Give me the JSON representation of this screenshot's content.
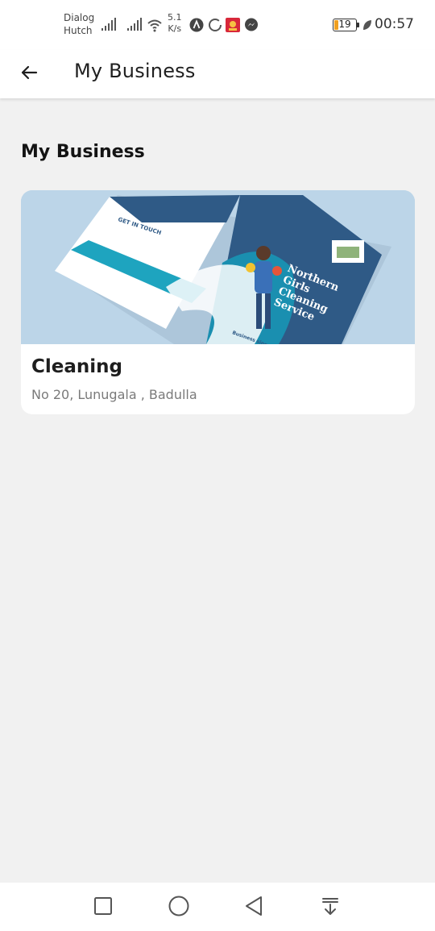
{
  "status_bar": {
    "carrier_line1": "Dialog",
    "carrier_line2": "Hutch",
    "speed_value": "5.1",
    "speed_unit": "K/s",
    "battery_level": "19",
    "battery_fraction": 0.19,
    "time": "00:57",
    "icons": [
      "signal-icon",
      "signal-icon",
      "wifi-icon",
      "app-a-icon",
      "loading-ring-icon",
      "app-red-icon",
      "messenger-icon",
      "battery-icon",
      "leaf-icon"
    ]
  },
  "app_bar": {
    "title": "My Business",
    "back_icon": "arrow-left-icon"
  },
  "main": {
    "section_title": "My Business",
    "businesses": [
      {
        "name": "Cleaning",
        "address": "No 20, Lunugala , Badulla",
        "image_text": {
          "headline": "Northern Girls Cleaning Service",
          "contact": "GET IN TOUCH",
          "since": "Business since 2018"
        }
      }
    ]
  },
  "nav_bar": {
    "icons": [
      "recents-square-icon",
      "home-circle-icon",
      "back-triangle-icon",
      "notification-pull-icon"
    ]
  },
  "colors": {
    "background": "#f1f1f1",
    "surface": "#ffffff",
    "brochure_navy": "#2f5a86",
    "brochure_teal": "#1ea4bf"
  }
}
